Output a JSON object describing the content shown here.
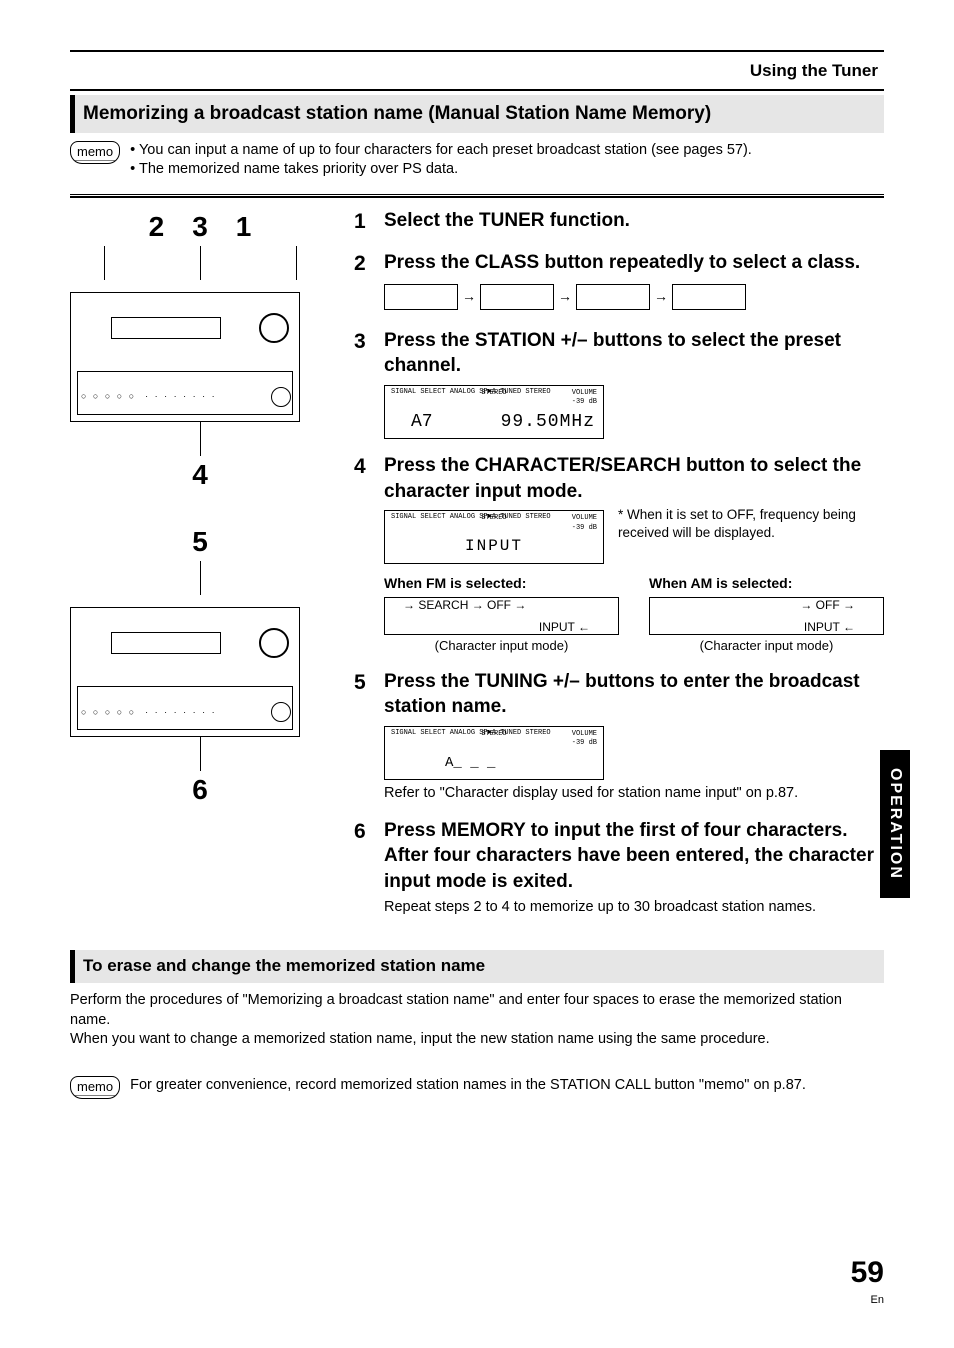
{
  "header": {
    "section": "Using the Tuner"
  },
  "title_bar": "Memorizing a broadcast station name (Manual Station Name Memory)",
  "memo": {
    "label": "memo",
    "items": [
      "You can input a name of up to four characters for each preset broadcast station (see pages 57).",
      "The memorized name takes priority over PS data."
    ]
  },
  "callouts": {
    "top": [
      "2",
      "3",
      "1"
    ],
    "mid_below": "4",
    "second_above": "5",
    "second_below": "6"
  },
  "steps": {
    "s1": {
      "num": "1",
      "title": "Select the TUNER function."
    },
    "s2": {
      "num": "2",
      "title": "Press the CLASS button repeatedly to select a class."
    },
    "s3": {
      "num": "3",
      "title": "Press the STATION +/– buttons to select the preset channel.",
      "lcd": {
        "small": "SIGNAL\nSELECT\nANALOG SP►A\nTUNED STEREO",
        "stereo": "STEREO",
        "vol_label": "VOLUME",
        "vol_value": "-39 dB",
        "preset": "A7",
        "freq": "99.50MHz"
      }
    },
    "s4": {
      "num": "4",
      "title": "Press the CHARACTER/SEARCH button to select the character input mode.",
      "lcd": {
        "small": "SIGNAL\nSELECT\nANALOG SP►A\nTUNED STEREO",
        "stereo": "STEREO",
        "vol_label": "VOLUME",
        "vol_value": "-39 dB",
        "center": "INPUT"
      },
      "note": "* When it is set to OFF, frequency being received will be displayed.",
      "fm": {
        "label": "When FM is selected:",
        "flow": "SEARCH → OFF",
        "input": "INPUT",
        "caption": "(Character input mode)"
      },
      "am": {
        "label": "When AM is selected:",
        "flow": "OFF",
        "input": "INPUT",
        "caption": "(Character input mode)"
      }
    },
    "s5": {
      "num": "5",
      "title": "Press the TUNING +/– buttons to enter the broadcast station name.",
      "lcd": {
        "small": "SIGNAL\nSELECT\nANALOG SP►A\nTUNED STEREO",
        "stereo": "STEREO",
        "vol_label": "VOLUME",
        "vol_value": "-39 dB",
        "blink": "A_ _ _"
      },
      "body": "Refer to \"Character display used for station name input\" on p.87."
    },
    "s6": {
      "num": "6",
      "title": "Press MEMORY to input the first of four characters.  After four characters have been entered, the character input mode is exited.",
      "body": "Repeat steps 2 to 4 to memorize up to 30 broadcast station names."
    }
  },
  "sub_section": {
    "title": "To erase and change the memorized station name",
    "body1": "Perform the procedures of \"Memorizing a broadcast station name\" and enter four spaces to erase the memorized station name.",
    "body2": "When you want to change a memorized station name, input the new station name using the same procedure."
  },
  "memo2": {
    "label": "memo",
    "text": "For greater convenience, record memorized station names in the STATION CALL button \"memo\" on p.87."
  },
  "side_tab": "OPERATION",
  "page": {
    "number": "59",
    "lang": "En"
  }
}
